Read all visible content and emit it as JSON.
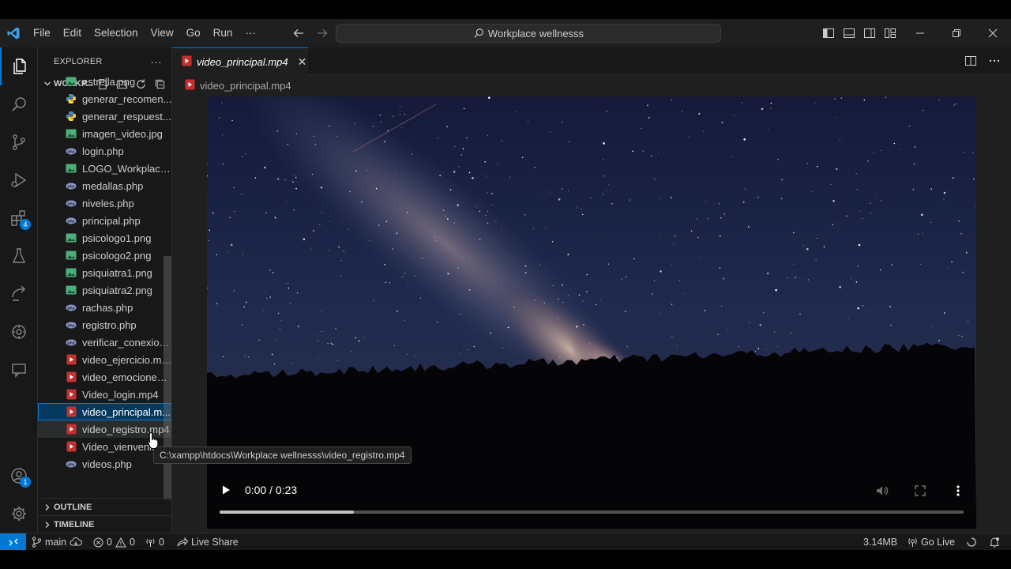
{
  "window": {
    "search_text": "Workplace wellnesss",
    "menu": [
      "File",
      "Edit",
      "Selection",
      "View",
      "Go",
      "Run",
      "···"
    ]
  },
  "activity_bar": {
    "extensions_badge": "4",
    "accounts_badge": "1"
  },
  "sidebar": {
    "title": "EXPLORER",
    "more": "···",
    "folder": "WORKP...",
    "files": [
      {
        "name": "estrella.png",
        "type": "image"
      },
      {
        "name": "generar_recomen...",
        "type": "python"
      },
      {
        "name": "generar_respuest...",
        "type": "python"
      },
      {
        "name": "imagen_video.jpg",
        "type": "image"
      },
      {
        "name": "login.php",
        "type": "php"
      },
      {
        "name": "LOGO_Workplace....",
        "type": "image"
      },
      {
        "name": "medallas.php",
        "type": "php"
      },
      {
        "name": "niveles.php",
        "type": "php"
      },
      {
        "name": "principal.php",
        "type": "php"
      },
      {
        "name": "psicologo1.png",
        "type": "image"
      },
      {
        "name": "psicologo2.png",
        "type": "image"
      },
      {
        "name": "psiquiatra1.png",
        "type": "image"
      },
      {
        "name": "psiquiatra2.png",
        "type": "image"
      },
      {
        "name": "rachas.php",
        "type": "php"
      },
      {
        "name": "registro.php",
        "type": "php"
      },
      {
        "name": "verificar_conexion...",
        "type": "php"
      },
      {
        "name": "video_ejercicio.mp4",
        "type": "video"
      },
      {
        "name": "video_emociones....",
        "type": "video"
      },
      {
        "name": "Video_login.mp4",
        "type": "video"
      },
      {
        "name": "video_principal.m...",
        "type": "video"
      },
      {
        "name": "video_registro.mp4",
        "type": "video"
      },
      {
        "name": "Video_vienvenida.mp4",
        "type": "video"
      },
      {
        "name": "videos.php",
        "type": "php"
      }
    ],
    "outline": "OUTLINE",
    "timeline": "TIMELINE"
  },
  "editor": {
    "tab_label": "video_principal.mp4",
    "tab_close": "✕",
    "breadcrumb": "video_principal.mp4",
    "video": {
      "current_time": "0:00 / 0:23",
      "progress": 0.18
    },
    "tooltip": "C:\\xampp\\htdocs\\Workplace wellnesss\\video_registro.mp4"
  },
  "status_bar": {
    "branch": "main",
    "errors": "0",
    "warnings": "0",
    "ports": "0",
    "live_share": "Live Share",
    "file_size": "3.14MB",
    "go_live": "Go Live"
  },
  "colors": {
    "accent": "#0078d4",
    "video_icon": "#c5302f",
    "image_icon": "#4caf7a",
    "php_icon": "#8c9bd0",
    "python_icon": "#4b8bbe"
  }
}
